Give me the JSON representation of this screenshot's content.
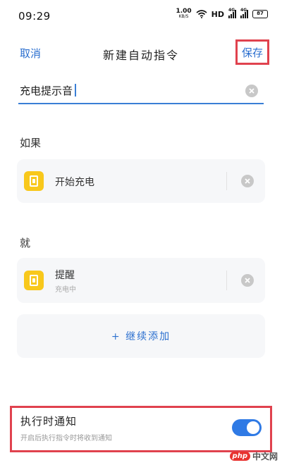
{
  "status_bar": {
    "time": "09:29",
    "net_speed": "1.00",
    "net_unit": "KB/S",
    "hd": "HD",
    "signal_tag": "4G",
    "battery": "87"
  },
  "header": {
    "cancel_label": "取消",
    "title": "新建自动指令",
    "save_label": "保存"
  },
  "name_input": {
    "value": "充电提示音"
  },
  "if_section": {
    "label": "如果",
    "condition": {
      "label": "开始充电"
    }
  },
  "then_section": {
    "label": "就",
    "action": {
      "label": "提醒",
      "sub": "充电中"
    },
    "add_label": "+ 继续添加"
  },
  "notify": {
    "title": "执行时通知",
    "description": "开启后执行指令时将收到通知",
    "enabled": true
  },
  "watermark": {
    "badge": "php",
    "site": "中文网"
  },
  "colors": {
    "accent": "#2b6fcf",
    "highlight_box": "#e0424e",
    "toggle_on": "#2f7ae5",
    "app_icon": "#f8c81c"
  }
}
